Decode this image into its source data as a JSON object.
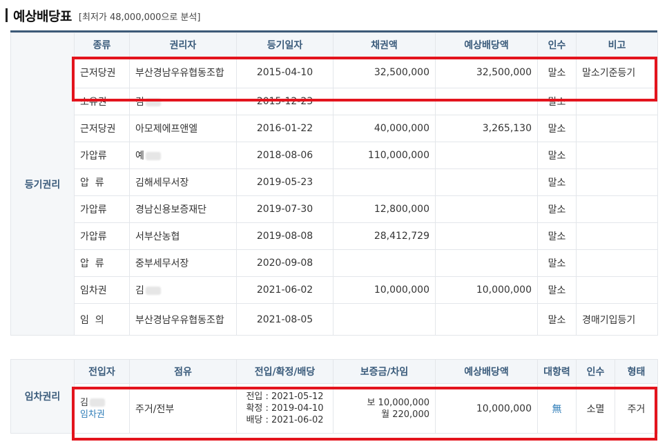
{
  "header": {
    "title": "예상배당표",
    "subtitle": "[최저가 48,000,000으로 분석]"
  },
  "registry": {
    "section_label": "등기권리",
    "columns": [
      "종류",
      "권리자",
      "등기일자",
      "채권액",
      "예상배당액",
      "인수",
      "비고"
    ],
    "rows": [
      {
        "type": "근저당권",
        "holder": "부산경남우유협동조합",
        "date": "2015-04-10",
        "claim": "32,500,000",
        "dividend": "32,500,000",
        "status": "말소",
        "note": "말소기준등기"
      },
      {
        "type": "소유권",
        "holder": "김",
        "date": "2015-12-23",
        "claim": "",
        "dividend": "",
        "status": "말소",
        "note": ""
      },
      {
        "type": "근저당권",
        "holder": "아모제에프앤엘",
        "date": "2016-01-22",
        "claim": "40,000,000",
        "dividend": "3,265,130",
        "status": "말소",
        "note": ""
      },
      {
        "type": "가압류",
        "holder": "예",
        "date": "2018-08-06",
        "claim": "110,000,000",
        "dividend": "",
        "status": "말소",
        "note": ""
      },
      {
        "type": "압  류",
        "holder": "김해세무서장",
        "date": "2019-05-23",
        "claim": "",
        "dividend": "",
        "status": "말소",
        "note": ""
      },
      {
        "type": "가압류",
        "holder": "경남신용보증재단",
        "date": "2019-07-30",
        "claim": "12,800,000",
        "dividend": "",
        "status": "말소",
        "note": ""
      },
      {
        "type": "가압류",
        "holder": "서부산농협",
        "date": "2019-08-08",
        "claim": "28,412,729",
        "dividend": "",
        "status": "말소",
        "note": ""
      },
      {
        "type": "압  류",
        "holder": "중부세무서장",
        "date": "2020-09-08",
        "claim": "",
        "dividend": "",
        "status": "말소",
        "note": ""
      },
      {
        "type": "임차권",
        "holder": "김",
        "date": "2021-06-02",
        "claim": "10,000,000",
        "dividend": "10,000,000",
        "status": "말소",
        "note": ""
      },
      {
        "type": "임  의",
        "holder": "부산경남우유협동조합",
        "date": "2021-08-05",
        "claim": "",
        "dividend": "",
        "status": "말소",
        "note": "경매기입등기"
      }
    ]
  },
  "tenant": {
    "section_label": "임차권리",
    "columns": [
      "전입자",
      "점유",
      "전입/확정/배당",
      "보증금/차임",
      "예상배당액",
      "대항력",
      "인수",
      "형태"
    ],
    "row": {
      "name": "김",
      "name_sub": "임차권",
      "occupancy": "주거/전부",
      "move_in": "전입 : 2021-05-12",
      "confirmed": "확정 : 2019-04-10",
      "dividend_date": "배당 : 2021-06-02",
      "deposit": "보 10,000,000",
      "rent": "월 220,000",
      "expected": "10,000,000",
      "opposing_power": "無",
      "takeover": "소멸",
      "form": "주거"
    }
  },
  "colors": {
    "accent": "#3c5a78",
    "header_text": "#3a5b7b",
    "highlight": "#e3141d",
    "link": "#2f7db8"
  }
}
